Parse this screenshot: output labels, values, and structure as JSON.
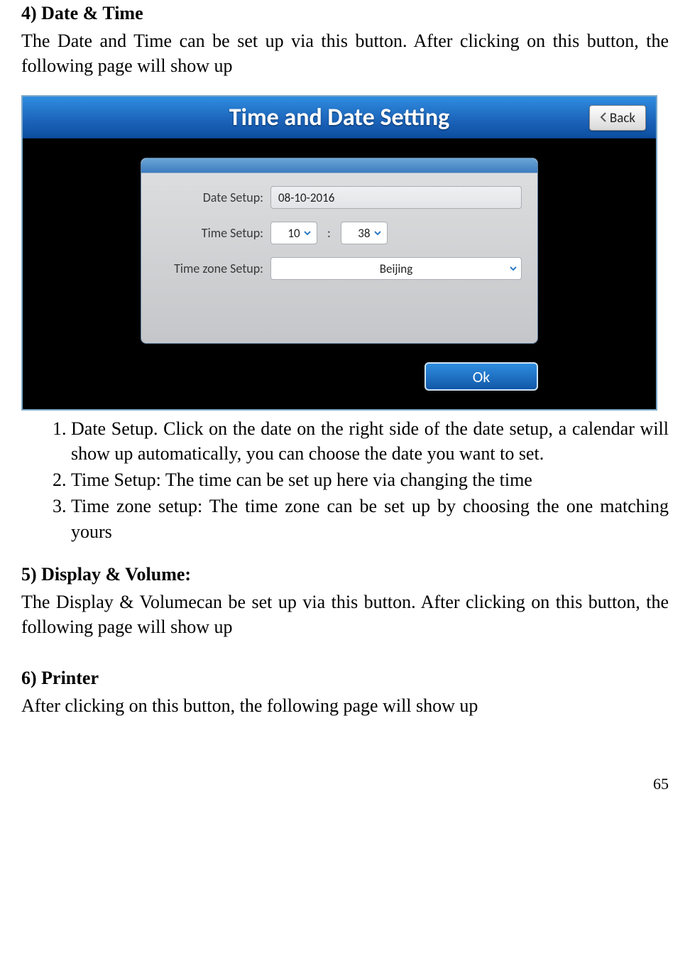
{
  "doc": {
    "sec4_heading": "4) Date & Time",
    "sec4_intro": "The Date and Time can be set up via this button. After clicking on this button, the following page will show up",
    "list": {
      "i1": "Date Setup. Click on the date on the right side of the date setup, a calendar will show up automatically, you can choose the date you want to set.",
      "i2": "Time Setup: The time can be set up here via changing the time",
      "i3": "Time zone setup: The time zone can be set up by choosing the one matching yours"
    },
    "sec5_heading": "5) Display & Volume:",
    "sec5_body": "The Display & Volumecan be set up via this button. After clicking on this button, the following page will show up",
    "sec6_heading": "6) Printer",
    "sec6_body": "After clicking on this button, the following page will show up",
    "page_number": "65"
  },
  "ui": {
    "title": "Time and Date Setting",
    "back": "Back",
    "labels": {
      "date": "Date Setup:",
      "time": "Time Setup:",
      "tz": "Time zone Setup:"
    },
    "date_value": "08-10-2016",
    "hour": "10",
    "minute": "38",
    "colon": ":",
    "tz_value": "Beijing",
    "ok": "Ok"
  }
}
